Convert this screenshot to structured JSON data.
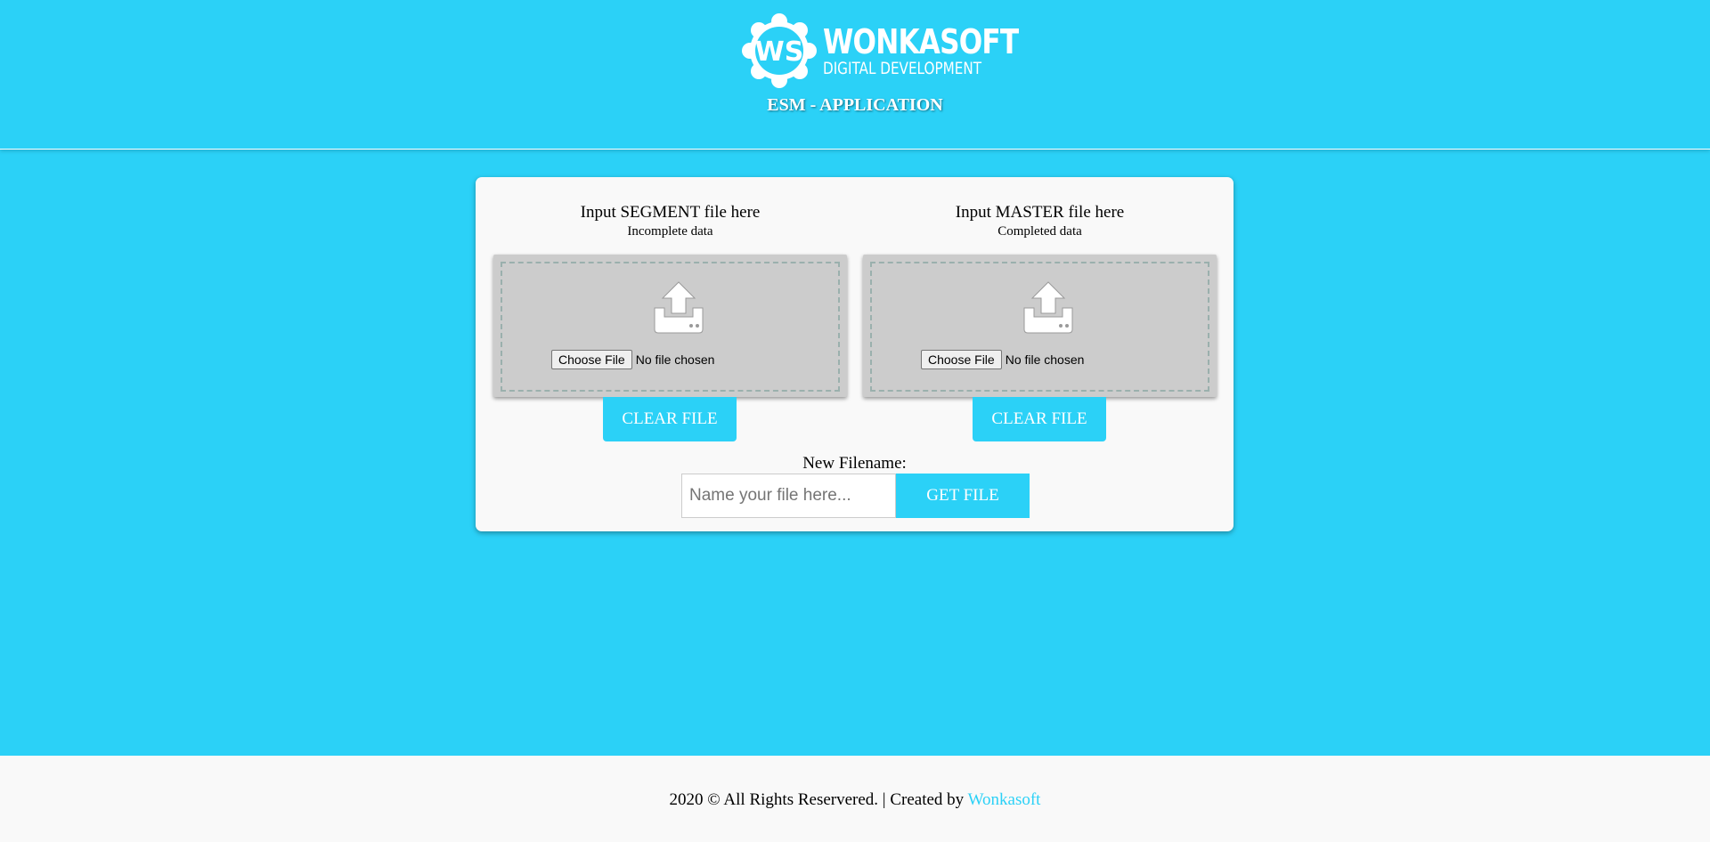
{
  "header": {
    "logo_initials": "WS",
    "logo_name": "WONKASOFT",
    "logo_sub": "DIGITAL DEVELOPMENT",
    "app_title": "ESM - APPLICATION"
  },
  "segment": {
    "title": "Input SEGMENT file here",
    "subtitle": "Incomplete data",
    "choose_label": "Choose File",
    "file_status": "No file chosen",
    "clear_label": "CLEAR FILE",
    "icon": "upload-icon"
  },
  "master": {
    "title": "Input MASTER file here",
    "subtitle": "Completed data",
    "choose_label": "Choose File",
    "file_status": "No file chosen",
    "clear_label": "CLEAR FILE",
    "icon": "upload-icon"
  },
  "filename": {
    "label": "New Filename:",
    "placeholder": "Name your file here...",
    "value": "",
    "get_label": "GET FILE"
  },
  "footer": {
    "text": "2020 © All Rights Reservered. | Created by ",
    "link_text": "Wonkasoft"
  },
  "colors": {
    "accent": "#2bd1f7",
    "card_bg": "#f9f9f9",
    "drop_bg": "#cccccc",
    "text": "#000000",
    "white": "#ffffff"
  }
}
